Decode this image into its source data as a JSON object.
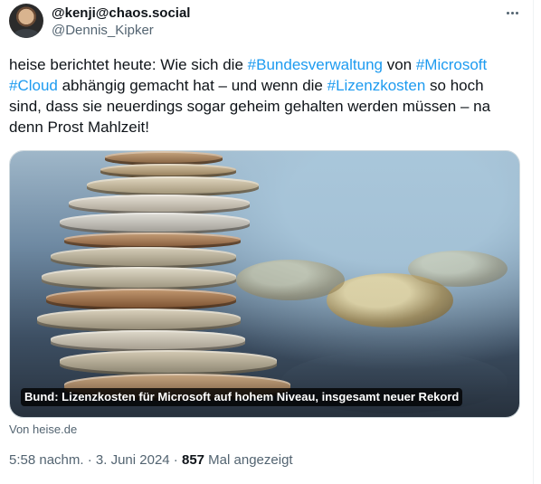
{
  "author": {
    "display_name": "@kenji@chaos.social",
    "handle": "@Dennis_Kipker"
  },
  "post": {
    "text_1": "heise berichtet heute: Wie sich die ",
    "tag_1": "#Bundesverwaltung",
    "text_2": " von ",
    "tag_2": "#Microsoft",
    "text_3": " ",
    "tag_3": "#Cloud",
    "text_4": " abhängig gemacht hat – und wenn die ",
    "tag_4": "#Lizenzkosten",
    "text_5": " so hoch sind, dass sie neuerdings sogar geheim gehalten werden müssen – na denn Prost Mahlzeit!"
  },
  "card": {
    "caption": "Bund: Lizenzkosten für Microsoft auf hohem Niveau, insgesamt neuer Rekord",
    "source": "Von heise.de"
  },
  "meta": {
    "time": "5:58 nachm.",
    "separator": " · ",
    "date": "3. Juni 2024",
    "views_count": "857",
    "views_label": " Mal angezeigt"
  },
  "icons": {
    "more": "more-horizontal-icon"
  },
  "colors": {
    "accent": "#1d9bf0",
    "text": "#0f1419",
    "muted": "#536471"
  }
}
